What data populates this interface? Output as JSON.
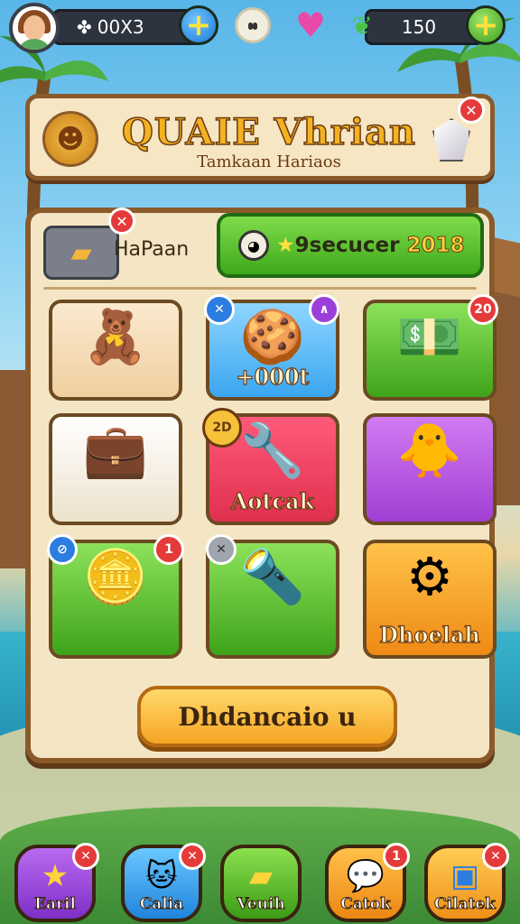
{
  "topbar": {
    "currency_left": "00X3",
    "currency_left_icon": "clover-icon",
    "currency_right": "150",
    "currency_right_icon": "leaf-gem-icon"
  },
  "banner": {
    "title": "QUAIE Vhrian",
    "subtitle": "Tamkaan Hariaos"
  },
  "panel": {
    "tab_label": "HaPaan",
    "promo_text": "9secucer",
    "promo_year": "2018"
  },
  "tiles": [
    {
      "label": "",
      "art": "🧸",
      "badge": ""
    },
    {
      "label": "+000t",
      "art": "🍪",
      "badge": ""
    },
    {
      "label": "",
      "art": "💵",
      "badge": "20"
    },
    {
      "label": "",
      "art": "💼",
      "badge": ""
    },
    {
      "label": "Aotcak",
      "art": "🔧",
      "badge": "2D"
    },
    {
      "label": "",
      "art": "🐥",
      "badge": ""
    },
    {
      "label": "",
      "art": "🪙",
      "badge": "1"
    },
    {
      "label": "",
      "art": "🔦",
      "badge": ""
    },
    {
      "label": "Dhoelah",
      "art": "⚙",
      "badge": ""
    }
  ],
  "main_button": "Dhdancaio u",
  "nav": [
    {
      "label": "Earil",
      "icon": "star-icon"
    },
    {
      "label": "Calia",
      "icon": "pet-icon"
    },
    {
      "label": "Veuih",
      "icon": "ticket-icon"
    },
    {
      "label": "Catok",
      "icon": "chat-icon",
      "badge": "1"
    },
    {
      "label": "Cilatek",
      "icon": "card-icon"
    }
  ],
  "colors": {
    "panel_border": "#8b5a2b",
    "accent_green": "#3ea81a",
    "accent_orange": "#f5a524"
  }
}
